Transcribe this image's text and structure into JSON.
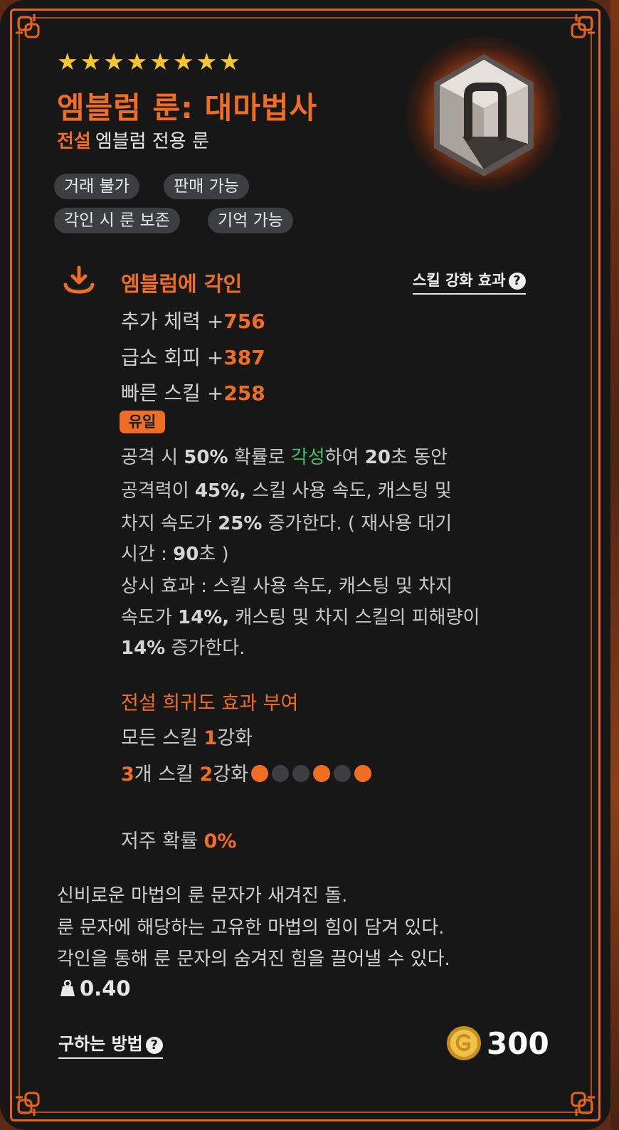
{
  "item": {
    "stars": 8,
    "title": "엠블럼 룬: 대마법사",
    "grade": "전설",
    "type": "엠블럼 전용 룬",
    "icon": "rune-stone-icon"
  },
  "tags": [
    "거래 불가",
    "판매 가능",
    "각인 시 룬 보존",
    "기억 가능"
  ],
  "engrave": {
    "title": "엠블럼에 각인",
    "skill_link": "스킬 강화 효과",
    "stats": [
      {
        "name": "추가 체력",
        "value": "756"
      },
      {
        "name": "급소 회피",
        "value": "387"
      },
      {
        "name": "빠른 스킬",
        "value": "258"
      }
    ],
    "unique_badge": "유일",
    "unique_lines": {
      "l1": {
        "a": "공격 시 ",
        "b1": "50%",
        "c": " 확률로 ",
        "awk": "각성",
        "d": "하여 ",
        "b2": "20",
        "e": "초 동안"
      },
      "l2": {
        "a": "공격력이 ",
        "b1": "45%,",
        "c": " 스킬 사용 속도, 캐스팅 및"
      },
      "l3": {
        "a": "차지 속도가 ",
        "b1": "25%",
        "c": " 증가한다. ( 재사용 대기"
      },
      "l4": {
        "a": "시간 : ",
        "b1": "90",
        "c": "초 )"
      },
      "l5": {
        "a": "상시 효과 : 스킬 사용 속도, 캐스팅 및 차지"
      },
      "l6": {
        "a": "속도가 ",
        "b1": "14%,",
        "c": " 캐스팅 및 차지 스킬의 피해량이"
      },
      "l7": {
        "b1": "14%",
        "c": " 증가한다."
      }
    }
  },
  "rarity": {
    "title": "전설 희귀도 효과 부여",
    "line1": {
      "a": "모든 스킬 ",
      "n": "1",
      "b": "강화"
    },
    "line2": {
      "n1": "3",
      "a": "개 스킬 ",
      "n2": "2",
      "b": "강화"
    },
    "dots": [
      "#f06e22",
      "#3d3e44",
      "#3d3e44",
      "#f06e22",
      "#3d3e44",
      "#f06e22"
    ]
  },
  "curse": {
    "label": "저주 확률 ",
    "value": "0%"
  },
  "lore": [
    "신비로운 마법의 룬 문자가 새겨진 돌.",
    "룬 문자에 해당하는 고유한 마법의 힘이 담겨 있다.",
    "각인을 통해 룬 문자의 숨겨진 힘을 끌어낼 수 있다."
  ],
  "weight": "0.40",
  "how_to_get": "구하는 방법",
  "price": "300",
  "colors": {
    "accent": "#f06e22",
    "awaken": "#3fc06a",
    "star": "#f7c530",
    "frame": "#e8641c"
  }
}
